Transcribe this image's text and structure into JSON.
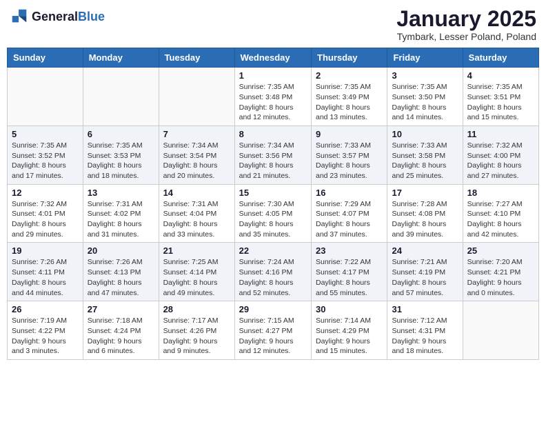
{
  "header": {
    "logo_general": "General",
    "logo_blue": "Blue",
    "month_title": "January 2025",
    "location": "Tymbark, Lesser Poland, Poland"
  },
  "weekdays": [
    "Sunday",
    "Monday",
    "Tuesday",
    "Wednesday",
    "Thursday",
    "Friday",
    "Saturday"
  ],
  "weeks": [
    [
      {
        "day": "",
        "info": ""
      },
      {
        "day": "",
        "info": ""
      },
      {
        "day": "",
        "info": ""
      },
      {
        "day": "1",
        "info": "Sunrise: 7:35 AM\nSunset: 3:48 PM\nDaylight: 8 hours\nand 12 minutes."
      },
      {
        "day": "2",
        "info": "Sunrise: 7:35 AM\nSunset: 3:49 PM\nDaylight: 8 hours\nand 13 minutes."
      },
      {
        "day": "3",
        "info": "Sunrise: 7:35 AM\nSunset: 3:50 PM\nDaylight: 8 hours\nand 14 minutes."
      },
      {
        "day": "4",
        "info": "Sunrise: 7:35 AM\nSunset: 3:51 PM\nDaylight: 8 hours\nand 15 minutes."
      }
    ],
    [
      {
        "day": "5",
        "info": "Sunrise: 7:35 AM\nSunset: 3:52 PM\nDaylight: 8 hours\nand 17 minutes."
      },
      {
        "day": "6",
        "info": "Sunrise: 7:35 AM\nSunset: 3:53 PM\nDaylight: 8 hours\nand 18 minutes."
      },
      {
        "day": "7",
        "info": "Sunrise: 7:34 AM\nSunset: 3:54 PM\nDaylight: 8 hours\nand 20 minutes."
      },
      {
        "day": "8",
        "info": "Sunrise: 7:34 AM\nSunset: 3:56 PM\nDaylight: 8 hours\nand 21 minutes."
      },
      {
        "day": "9",
        "info": "Sunrise: 7:33 AM\nSunset: 3:57 PM\nDaylight: 8 hours\nand 23 minutes."
      },
      {
        "day": "10",
        "info": "Sunrise: 7:33 AM\nSunset: 3:58 PM\nDaylight: 8 hours\nand 25 minutes."
      },
      {
        "day": "11",
        "info": "Sunrise: 7:32 AM\nSunset: 4:00 PM\nDaylight: 8 hours\nand 27 minutes."
      }
    ],
    [
      {
        "day": "12",
        "info": "Sunrise: 7:32 AM\nSunset: 4:01 PM\nDaylight: 8 hours\nand 29 minutes."
      },
      {
        "day": "13",
        "info": "Sunrise: 7:31 AM\nSunset: 4:02 PM\nDaylight: 8 hours\nand 31 minutes."
      },
      {
        "day": "14",
        "info": "Sunrise: 7:31 AM\nSunset: 4:04 PM\nDaylight: 8 hours\nand 33 minutes."
      },
      {
        "day": "15",
        "info": "Sunrise: 7:30 AM\nSunset: 4:05 PM\nDaylight: 8 hours\nand 35 minutes."
      },
      {
        "day": "16",
        "info": "Sunrise: 7:29 AM\nSunset: 4:07 PM\nDaylight: 8 hours\nand 37 minutes."
      },
      {
        "day": "17",
        "info": "Sunrise: 7:28 AM\nSunset: 4:08 PM\nDaylight: 8 hours\nand 39 minutes."
      },
      {
        "day": "18",
        "info": "Sunrise: 7:27 AM\nSunset: 4:10 PM\nDaylight: 8 hours\nand 42 minutes."
      }
    ],
    [
      {
        "day": "19",
        "info": "Sunrise: 7:26 AM\nSunset: 4:11 PM\nDaylight: 8 hours\nand 44 minutes."
      },
      {
        "day": "20",
        "info": "Sunrise: 7:26 AM\nSunset: 4:13 PM\nDaylight: 8 hours\nand 47 minutes."
      },
      {
        "day": "21",
        "info": "Sunrise: 7:25 AM\nSunset: 4:14 PM\nDaylight: 8 hours\nand 49 minutes."
      },
      {
        "day": "22",
        "info": "Sunrise: 7:24 AM\nSunset: 4:16 PM\nDaylight: 8 hours\nand 52 minutes."
      },
      {
        "day": "23",
        "info": "Sunrise: 7:22 AM\nSunset: 4:17 PM\nDaylight: 8 hours\nand 55 minutes."
      },
      {
        "day": "24",
        "info": "Sunrise: 7:21 AM\nSunset: 4:19 PM\nDaylight: 8 hours\nand 57 minutes."
      },
      {
        "day": "25",
        "info": "Sunrise: 7:20 AM\nSunset: 4:21 PM\nDaylight: 9 hours\nand 0 minutes."
      }
    ],
    [
      {
        "day": "26",
        "info": "Sunrise: 7:19 AM\nSunset: 4:22 PM\nDaylight: 9 hours\nand 3 minutes."
      },
      {
        "day": "27",
        "info": "Sunrise: 7:18 AM\nSunset: 4:24 PM\nDaylight: 9 hours\nand 6 minutes."
      },
      {
        "day": "28",
        "info": "Sunrise: 7:17 AM\nSunset: 4:26 PM\nDaylight: 9 hours\nand 9 minutes."
      },
      {
        "day": "29",
        "info": "Sunrise: 7:15 AM\nSunset: 4:27 PM\nDaylight: 9 hours\nand 12 minutes."
      },
      {
        "day": "30",
        "info": "Sunrise: 7:14 AM\nSunset: 4:29 PM\nDaylight: 9 hours\nand 15 minutes."
      },
      {
        "day": "31",
        "info": "Sunrise: 7:12 AM\nSunset: 4:31 PM\nDaylight: 9 hours\nand 18 minutes."
      },
      {
        "day": "",
        "info": ""
      }
    ]
  ]
}
